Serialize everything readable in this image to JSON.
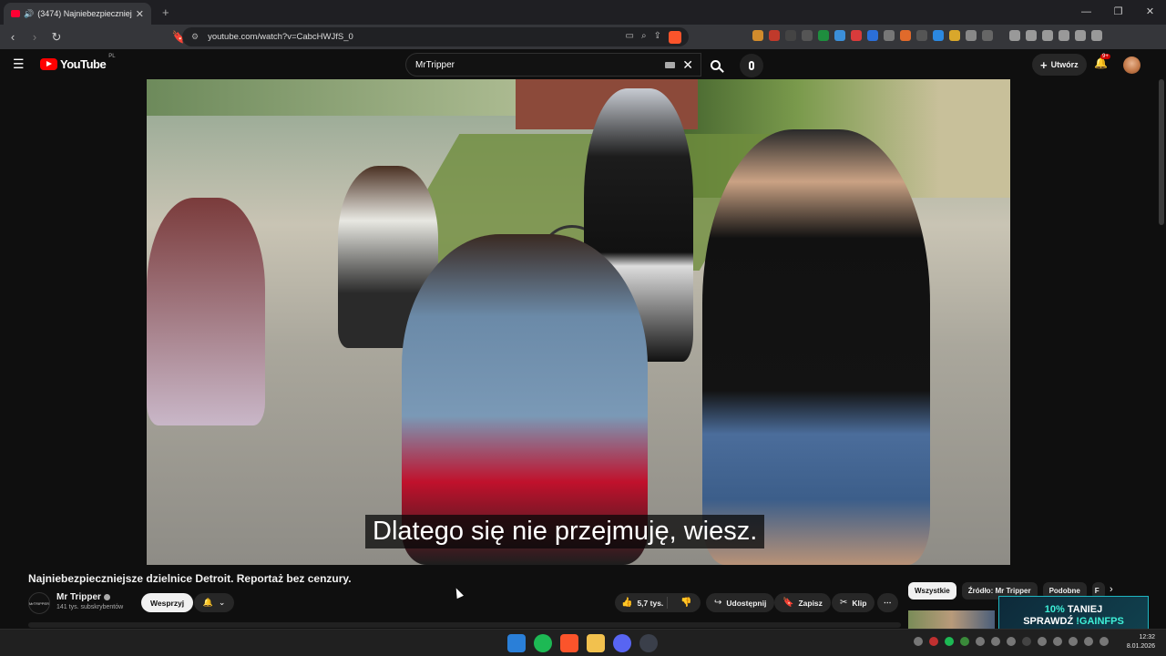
{
  "browser": {
    "tab_title": "(3474) Najniebezpieczniejsze",
    "new_tab": "+",
    "url": "youtube.com/watch?v=CabcHWJfS_0",
    "window_controls": [
      "—",
      "❐",
      "✕"
    ]
  },
  "youtube": {
    "logo_text": "YouTube",
    "country_code": "PL",
    "search_value": "MrTripper",
    "create_label": "Utwórz",
    "notifications_badge": "9+"
  },
  "video": {
    "subtitle": "Dlatego się nie przejmuję, wiesz.",
    "title": "Najniebezpieczniejsze dzielnice Detroit. Reportaż bez cenzury."
  },
  "channel": {
    "icon_text": "MrTRIPPER",
    "name": "Mr Tripper",
    "subscribers": "141 tys. subskrybentów",
    "support_label": "Wesprzyj"
  },
  "actions": {
    "likes": "5,7 tys.",
    "share": "Udostępnij",
    "save": "Zapisz",
    "clip": "Klip",
    "more": "⋯"
  },
  "chips": [
    "Wszystkie",
    "Źródło: Mr Tripper",
    "Podobne",
    "F"
  ],
  "promo": {
    "line1_accent": "10%",
    "line1_rest": " TANIEJ",
    "line2": "SPRAWDŹ ",
    "line2_accent": "!GAINFPS"
  },
  "taskbar": {
    "time": "12:32",
    "date": "8.01.2026"
  },
  "colors": {
    "background": "#0f0f0f",
    "youtube_red": "#ff0000",
    "promo_accent": "#3ef0d8"
  }
}
